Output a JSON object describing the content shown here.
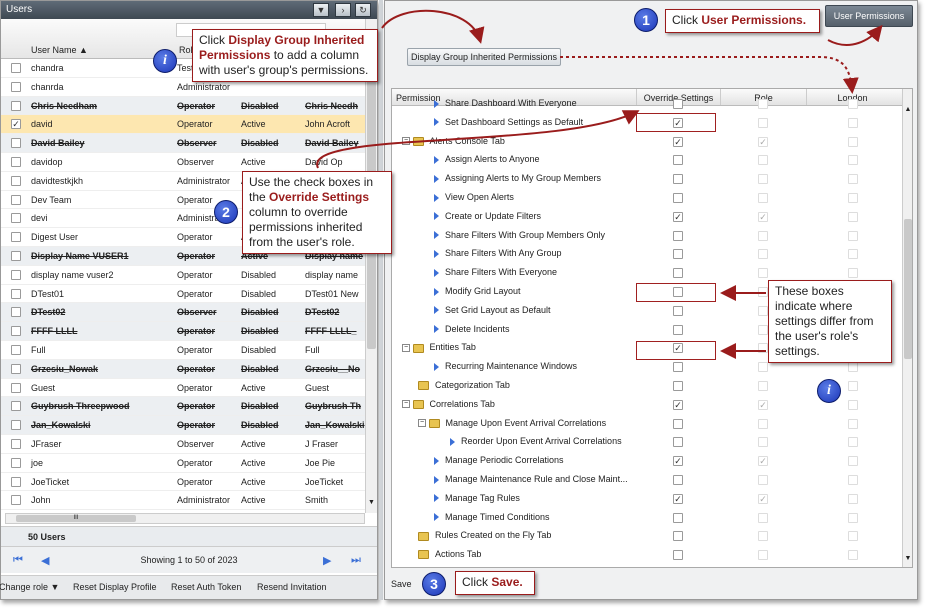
{
  "left_panel": {
    "title": "Users",
    "columns": {
      "name": "User Name",
      "role": "Role"
    },
    "rows": [
      {
        "name": "chandra",
        "role": "Tester",
        "status": "",
        "display": "",
        "checked": false,
        "struck": false
      },
      {
        "name": "chanrda",
        "role": "Administrator",
        "status": "",
        "display": "",
        "checked": false,
        "struck": false
      },
      {
        "name": "Chris Needham",
        "role": "Operator",
        "status": "Disabled",
        "display": "Chris Needh",
        "checked": false,
        "struck": true
      },
      {
        "name": "david",
        "role": "Operator",
        "status": "Active",
        "display": "John Acroft",
        "checked": true,
        "struck": false,
        "selected": true
      },
      {
        "name": "David Bailey",
        "role": "Observer",
        "status": "Disabled",
        "display": "David Bailey",
        "checked": false,
        "struck": true
      },
      {
        "name": "davidop",
        "role": "Observer",
        "status": "Active",
        "display": "David Op",
        "checked": false,
        "struck": false
      },
      {
        "name": "davidtestkjkh",
        "role": "Administrator",
        "status": "Active",
        "display": "",
        "checked": false,
        "struck": false
      },
      {
        "name": "Dev Team",
        "role": "Operator",
        "status": "",
        "display": "",
        "checked": false,
        "struck": false
      },
      {
        "name": "devi",
        "role": "Administrator",
        "status": "",
        "display": "",
        "checked": false,
        "struck": false
      },
      {
        "name": "Digest User",
        "role": "Operator",
        "status": "Active",
        "display": "",
        "checked": false,
        "struck": false
      },
      {
        "name": "Display Name VUSER1",
        "role": "Operator",
        "status": "Active",
        "display": "Display name",
        "checked": false,
        "struck": true
      },
      {
        "name": "display name vuser2",
        "role": "Operator",
        "status": "Disabled",
        "display": "display name",
        "checked": false,
        "struck": false
      },
      {
        "name": "DTest01",
        "role": "Operator",
        "status": "Disabled",
        "display": "DTest01 New",
        "checked": false,
        "struck": false
      },
      {
        "name": "DTest02",
        "role": "Observer",
        "status": "Disabled",
        "display": "DTest02",
        "checked": false,
        "struck": true
      },
      {
        "name": "FFFF LLLL",
        "role": "Operator",
        "status": "Disabled",
        "display": "FFFF LLLL_",
        "checked": false,
        "struck": true
      },
      {
        "name": "Full",
        "role": "Operator",
        "status": "Disabled",
        "display": "Full",
        "checked": false,
        "struck": false
      },
      {
        "name": "Grzesiu_Nowak",
        "role": "Operator",
        "status": "Disabled",
        "display": "Grzesiu__No",
        "checked": false,
        "struck": true
      },
      {
        "name": "Guest",
        "role": "Operator",
        "status": "Active",
        "display": "Guest",
        "checked": false,
        "struck": false
      },
      {
        "name": "Guybrush Threepwood",
        "role": "Operator",
        "status": "Disabled",
        "display": "Guybrush Th",
        "checked": false,
        "struck": true
      },
      {
        "name": "Jan_Kowalski",
        "role": "Operator",
        "status": "Disabled",
        "display": "Jan_Kowalski",
        "checked": false,
        "struck": true
      },
      {
        "name": "JFraser",
        "role": "Observer",
        "status": "Active",
        "display": "J Fraser",
        "checked": false,
        "struck": false
      },
      {
        "name": "joe",
        "role": "Operator",
        "status": "Active",
        "display": "Joe Pie",
        "checked": false,
        "struck": false
      },
      {
        "name": "JoeTicket",
        "role": "Operator",
        "status": "Active",
        "display": "JoeTicket",
        "checked": false,
        "struck": false
      },
      {
        "name": "John",
        "role": "Administrator",
        "status": "Active",
        "display": "Smith",
        "checked": false,
        "struck": false
      }
    ],
    "hscroll_label": "III",
    "count_label": "50 Users",
    "pager_text": "Showing 1 to 50 of 2023",
    "footer": {
      "change_role": "Change role",
      "reset_display": "Reset Display Profile",
      "reset_auth": "Reset Auth Token",
      "resend": "Resend Invitation"
    }
  },
  "right_panel": {
    "tab_label": "User Permissions",
    "display_group_button": "Display Group Inherited Permissions",
    "columns": {
      "permission": "Permission",
      "override": "Override Settings",
      "role": "Role",
      "london": "London"
    },
    "rows": [
      {
        "label": "Share Dashboard With Everyone",
        "level": 2,
        "kind": "leaf",
        "override": false,
        "role": false,
        "london": false
      },
      {
        "label": "Set Dashboard Settings as Default",
        "level": 2,
        "kind": "leaf",
        "override": true,
        "role": false,
        "london": false
      },
      {
        "label": "Alerts Console Tab",
        "level": 0,
        "kind": "folder",
        "override": true,
        "role": true,
        "london": false
      },
      {
        "label": "Assign Alerts to Anyone",
        "level": 2,
        "kind": "leaf",
        "override": false,
        "role": false,
        "london": false
      },
      {
        "label": "Assigning Alerts to My Group Members",
        "level": 2,
        "kind": "leaf",
        "override": false,
        "role": false,
        "london": false
      },
      {
        "label": "View Open Alerts",
        "level": 2,
        "kind": "leaf",
        "override": false,
        "role": false,
        "london": false
      },
      {
        "label": "Create or Update Filters",
        "level": 2,
        "kind": "leaf",
        "override": true,
        "role": true,
        "london": false
      },
      {
        "label": "Share Filters With Group Members Only",
        "level": 2,
        "kind": "leaf",
        "override": false,
        "role": false,
        "london": false
      },
      {
        "label": "Share Filters With Any Group",
        "level": 2,
        "kind": "leaf",
        "override": false,
        "role": false,
        "london": false
      },
      {
        "label": "Share Filters With Everyone",
        "level": 2,
        "kind": "leaf",
        "override": false,
        "role": false,
        "london": false
      },
      {
        "label": "Modify Grid Layout",
        "level": 2,
        "kind": "leaf",
        "override": false,
        "role": false,
        "london": false
      },
      {
        "label": "Set Grid Layout as Default",
        "level": 2,
        "kind": "leaf",
        "override": false,
        "role": false,
        "london": false
      },
      {
        "label": "Delete Incidents",
        "level": 2,
        "kind": "leaf",
        "override": false,
        "role": false,
        "london": false
      },
      {
        "label": "Entities Tab",
        "level": 0,
        "kind": "folder",
        "override": true,
        "role": false,
        "london": false
      },
      {
        "label": "Recurring Maintenance Windows",
        "level": 2,
        "kind": "leaf",
        "override": false,
        "role": false,
        "london": false
      },
      {
        "label": "Categorization Tab",
        "level": 1,
        "kind": "folder-noexp",
        "override": false,
        "role": false,
        "london": false
      },
      {
        "label": "Correlations Tab",
        "level": 0,
        "kind": "folder",
        "override": true,
        "role": true,
        "london": false
      },
      {
        "label": "Manage Upon Event Arrival Correlations",
        "level": 1,
        "kind": "folder",
        "override": false,
        "role": false,
        "london": false
      },
      {
        "label": "Reorder Upon Event Arrival Correlations",
        "level": 3,
        "kind": "leaf",
        "override": false,
        "role": false,
        "london": false
      },
      {
        "label": "Manage Periodic Correlations",
        "level": 2,
        "kind": "leaf",
        "override": true,
        "role": true,
        "london": false
      },
      {
        "label": "Manage Maintenance Rule and Close Maint...",
        "level": 2,
        "kind": "leaf",
        "override": false,
        "role": false,
        "london": false
      },
      {
        "label": "Manage Tag Rules",
        "level": 2,
        "kind": "leaf",
        "override": true,
        "role": true,
        "london": false
      },
      {
        "label": "Manage Timed Conditions",
        "level": 2,
        "kind": "leaf",
        "override": false,
        "role": false,
        "london": false
      },
      {
        "label": "Rules Created on the Fly Tab",
        "level": 1,
        "kind": "folder-noexp",
        "override": false,
        "role": false,
        "london": false
      },
      {
        "label": "Actions Tab",
        "level": 1,
        "kind": "folder-noexp",
        "override": false,
        "role": false,
        "london": false
      }
    ],
    "save_label": "Save"
  },
  "callouts": {
    "c1_prefix": "Click ",
    "c1_bold": "User Permissions.",
    "c_info1_prefix": "Click ",
    "c_info1_bold": "Display Group Inherited Permissions",
    "c_info1_suffix": " to add a column with user's group's permissions.",
    "c2_prefix": "Use the check boxes in the ",
    "c2_bold": "Override Settings",
    "c2_suffix": " column to override permissions inherited from the user's role.",
    "c3_prefix": "Click ",
    "c3_bold": "Save.",
    "c_boxes": "These boxes indicate where settings differ from the user's role's settings.",
    "badge1": "1",
    "badge2": "2",
    "badge3": "3",
    "info": "i"
  },
  "colors": {
    "accent_red": "#9a1c1c",
    "badge_blue": "#1c36b8",
    "folder": "#e8c451",
    "tree_arrow": "#3b6fd6",
    "selected_row": "#fde7b0"
  }
}
